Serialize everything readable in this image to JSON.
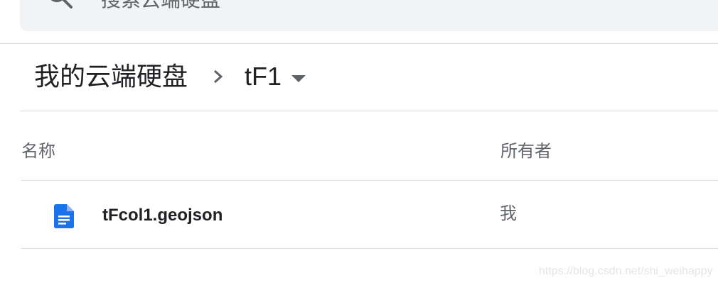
{
  "search": {
    "placeholder": "搜索云端硬盘",
    "icon": "search-icon"
  },
  "breadcrumb": {
    "root": "我的云端硬盘",
    "separator_icon": "chevron-right-icon",
    "current": "tF1",
    "dropdown_icon": "caret-down-icon"
  },
  "table": {
    "columns": {
      "name": "名称",
      "owner": "所有者"
    },
    "rows": [
      {
        "name": "tFcol1.geojson",
        "owner": "我",
        "icon": "document-icon"
      }
    ]
  },
  "watermark": "https://blog.csdn.net/shi_weihappy",
  "colors": {
    "search_bg": "#f1f3f4",
    "divider": "#dadce0",
    "doc_icon": "#1a73e8",
    "text_primary": "#202124",
    "text_secondary": "#5f6368"
  }
}
